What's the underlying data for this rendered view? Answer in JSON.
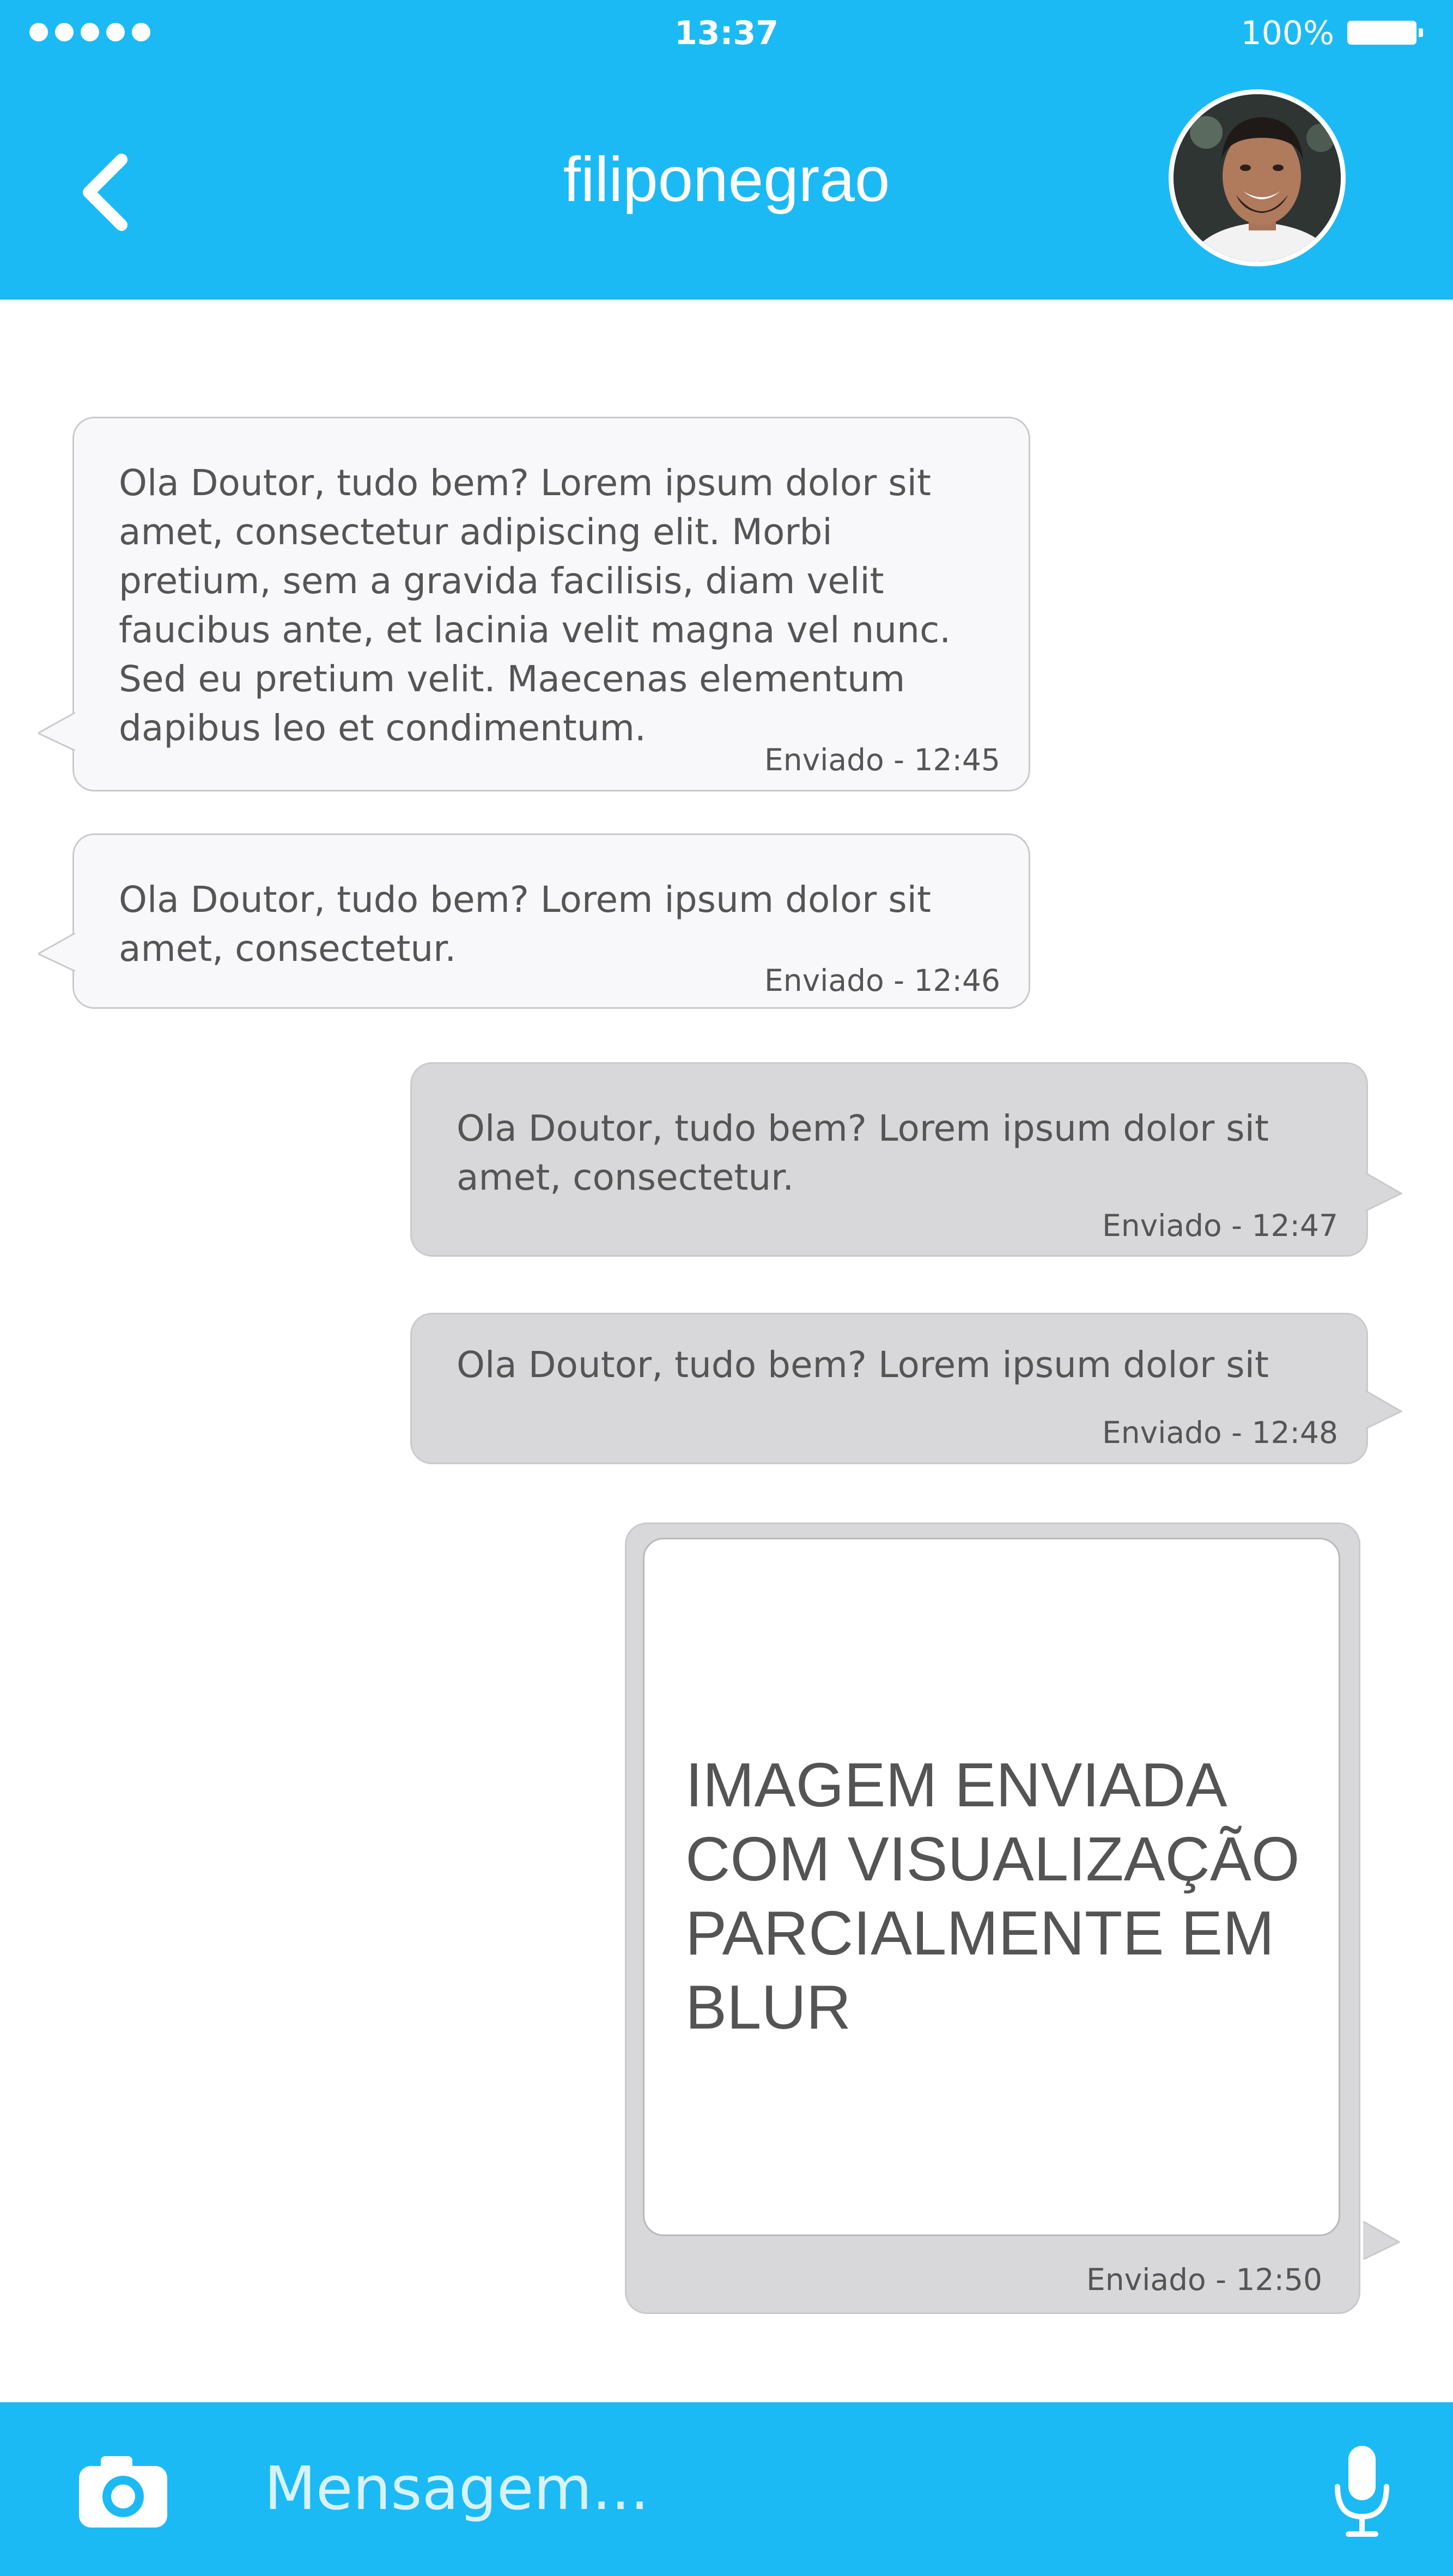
{
  "status_bar": {
    "time": "13:37",
    "battery": "100%"
  },
  "header": {
    "title": "filiponegrao"
  },
  "messages": [
    {
      "text": "Ola Doutor, tudo bem? Lorem ipsum dolor sit amet, consectetur adipiscing elit. Morbi pretium, sem a gravida facilisis, diam velit faucibus ante, et lacinia velit magna vel nunc. Sed eu pretium velit. Maecenas elementum dapibus leo et condimentum.",
      "time": "Enviado - 12:45"
    },
    {
      "text": "Ola Doutor, tudo bem? Lorem ipsum dolor sit amet, consectetur.",
      "time": "Enviado - 12:46"
    },
    {
      "text": "Ola Doutor, tudo bem? Lorem ipsum dolor sit amet, consectetur.",
      "time": "Enviado - 12:47"
    },
    {
      "text": "Ola Doutor, tudo bem? Lorem ipsum dolor sit",
      "time": "Enviado - 12:48"
    },
    {
      "image_caption": "IMAGEM ENVIADA COM VISUALIZAÇÃO PARCIALMENTE EM BLUR",
      "time": "Enviado - 12:50"
    }
  ],
  "composer": {
    "placeholder": "Mensagem..."
  },
  "colors": {
    "accent": "#1cbaf4",
    "incoming_bubble": "#f8f8fa",
    "outgoing_bubble": "#d8d8da",
    "text": "#555555"
  },
  "icons": {
    "back": "chevron-left-icon",
    "camera": "camera-icon",
    "mic": "microphone-icon",
    "signal": "signal-dots-icon",
    "battery": "battery-icon"
  }
}
